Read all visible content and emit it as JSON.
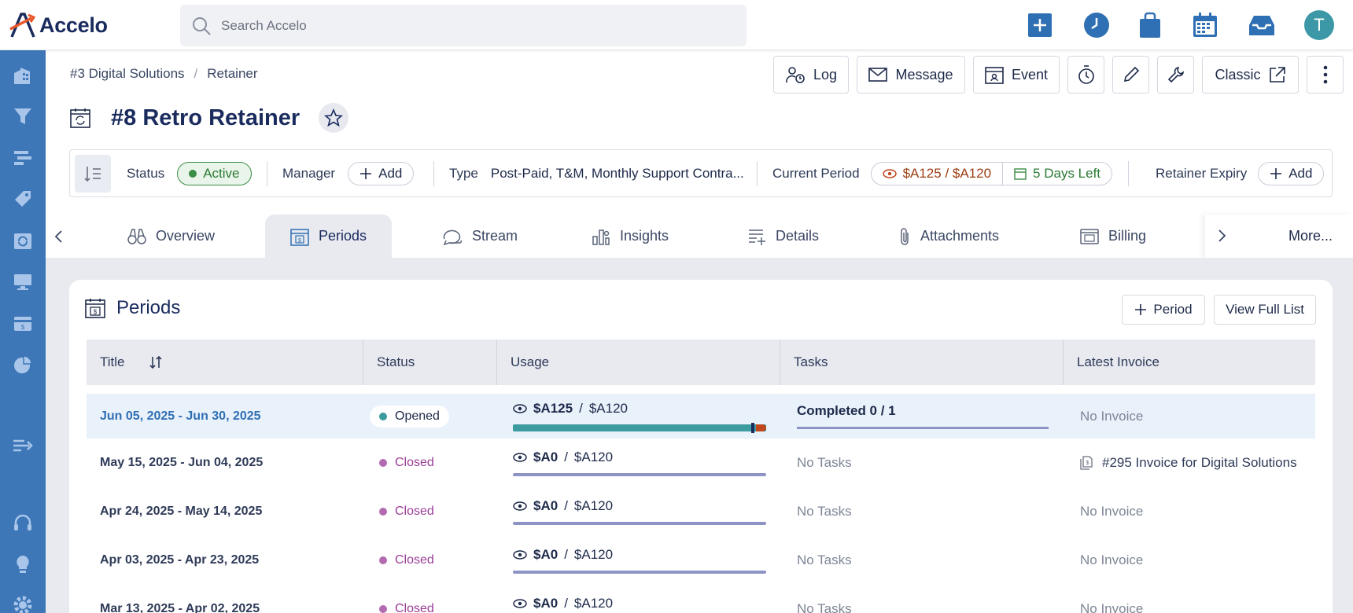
{
  "app": {
    "name": "Accelo"
  },
  "search": {
    "placeholder": "Search Accelo"
  },
  "user": {
    "initial": "T"
  },
  "breadcrumb": [
    "#3 Digital Solutions",
    "Retainer"
  ],
  "actions": {
    "log": "Log",
    "message": "Message",
    "event": "Event",
    "classic": "Classic"
  },
  "page": {
    "title": "#8 Retro Retainer"
  },
  "strip": {
    "status_label": "Status",
    "status_value": "Active",
    "manager_label": "Manager",
    "manager_add": "Add",
    "type_label": "Type",
    "type_value": "Post-Paid, T&M, Monthly Support Contra...",
    "period_label": "Current Period",
    "period_amount": "$A125 / $A120",
    "period_days": "5 Days Left",
    "expiry_label": "Retainer Expiry",
    "expiry_add": "Add"
  },
  "tabs": [
    "Overview",
    "Periods",
    "Stream",
    "Insights",
    "Details",
    "Attachments",
    "Billing"
  ],
  "tabs_more": "More...",
  "card": {
    "title": "Periods",
    "add_period": "Period",
    "view_full": "View Full List"
  },
  "table": {
    "headers": [
      "Title",
      "Status",
      "Usage",
      "Tasks",
      "Latest Invoice"
    ],
    "rows": [
      {
        "title": "Jun 05, 2025 - Jun 30, 2025",
        "status": "Opened",
        "used": "$A125",
        "limit": "$A120",
        "tasks": "Completed 0 / 1",
        "invoice": "No Invoice"
      },
      {
        "title": "May 15, 2025 - Jun 04, 2025",
        "status": "Closed",
        "used": "$A0",
        "limit": "$A120",
        "tasks": "No Tasks",
        "invoice": "#295 Invoice for Digital Solutions"
      },
      {
        "title": "Apr 24, 2025 - May 14, 2025",
        "status": "Closed",
        "used": "$A0",
        "limit": "$A120",
        "tasks": "No Tasks",
        "invoice": "No Invoice"
      },
      {
        "title": "Apr 03, 2025 - Apr 23, 2025",
        "status": "Closed",
        "used": "$A0",
        "limit": "$A120",
        "tasks": "No Tasks",
        "invoice": "No Invoice"
      },
      {
        "title": "Mar 13, 2025 - Apr 02, 2025",
        "status": "Closed",
        "used": "$A0",
        "limit": "$A120",
        "tasks": "No Tasks",
        "invoice": "No Invoice"
      }
    ]
  },
  "colors": {
    "brand_navy": "#1a2b5e",
    "sidebar": "#3d77b8",
    "active_green": "#2c7a33",
    "opened_teal": "#3b9b9e",
    "closed_purple": "#9b3d98",
    "over_budget": "#c0461c"
  }
}
